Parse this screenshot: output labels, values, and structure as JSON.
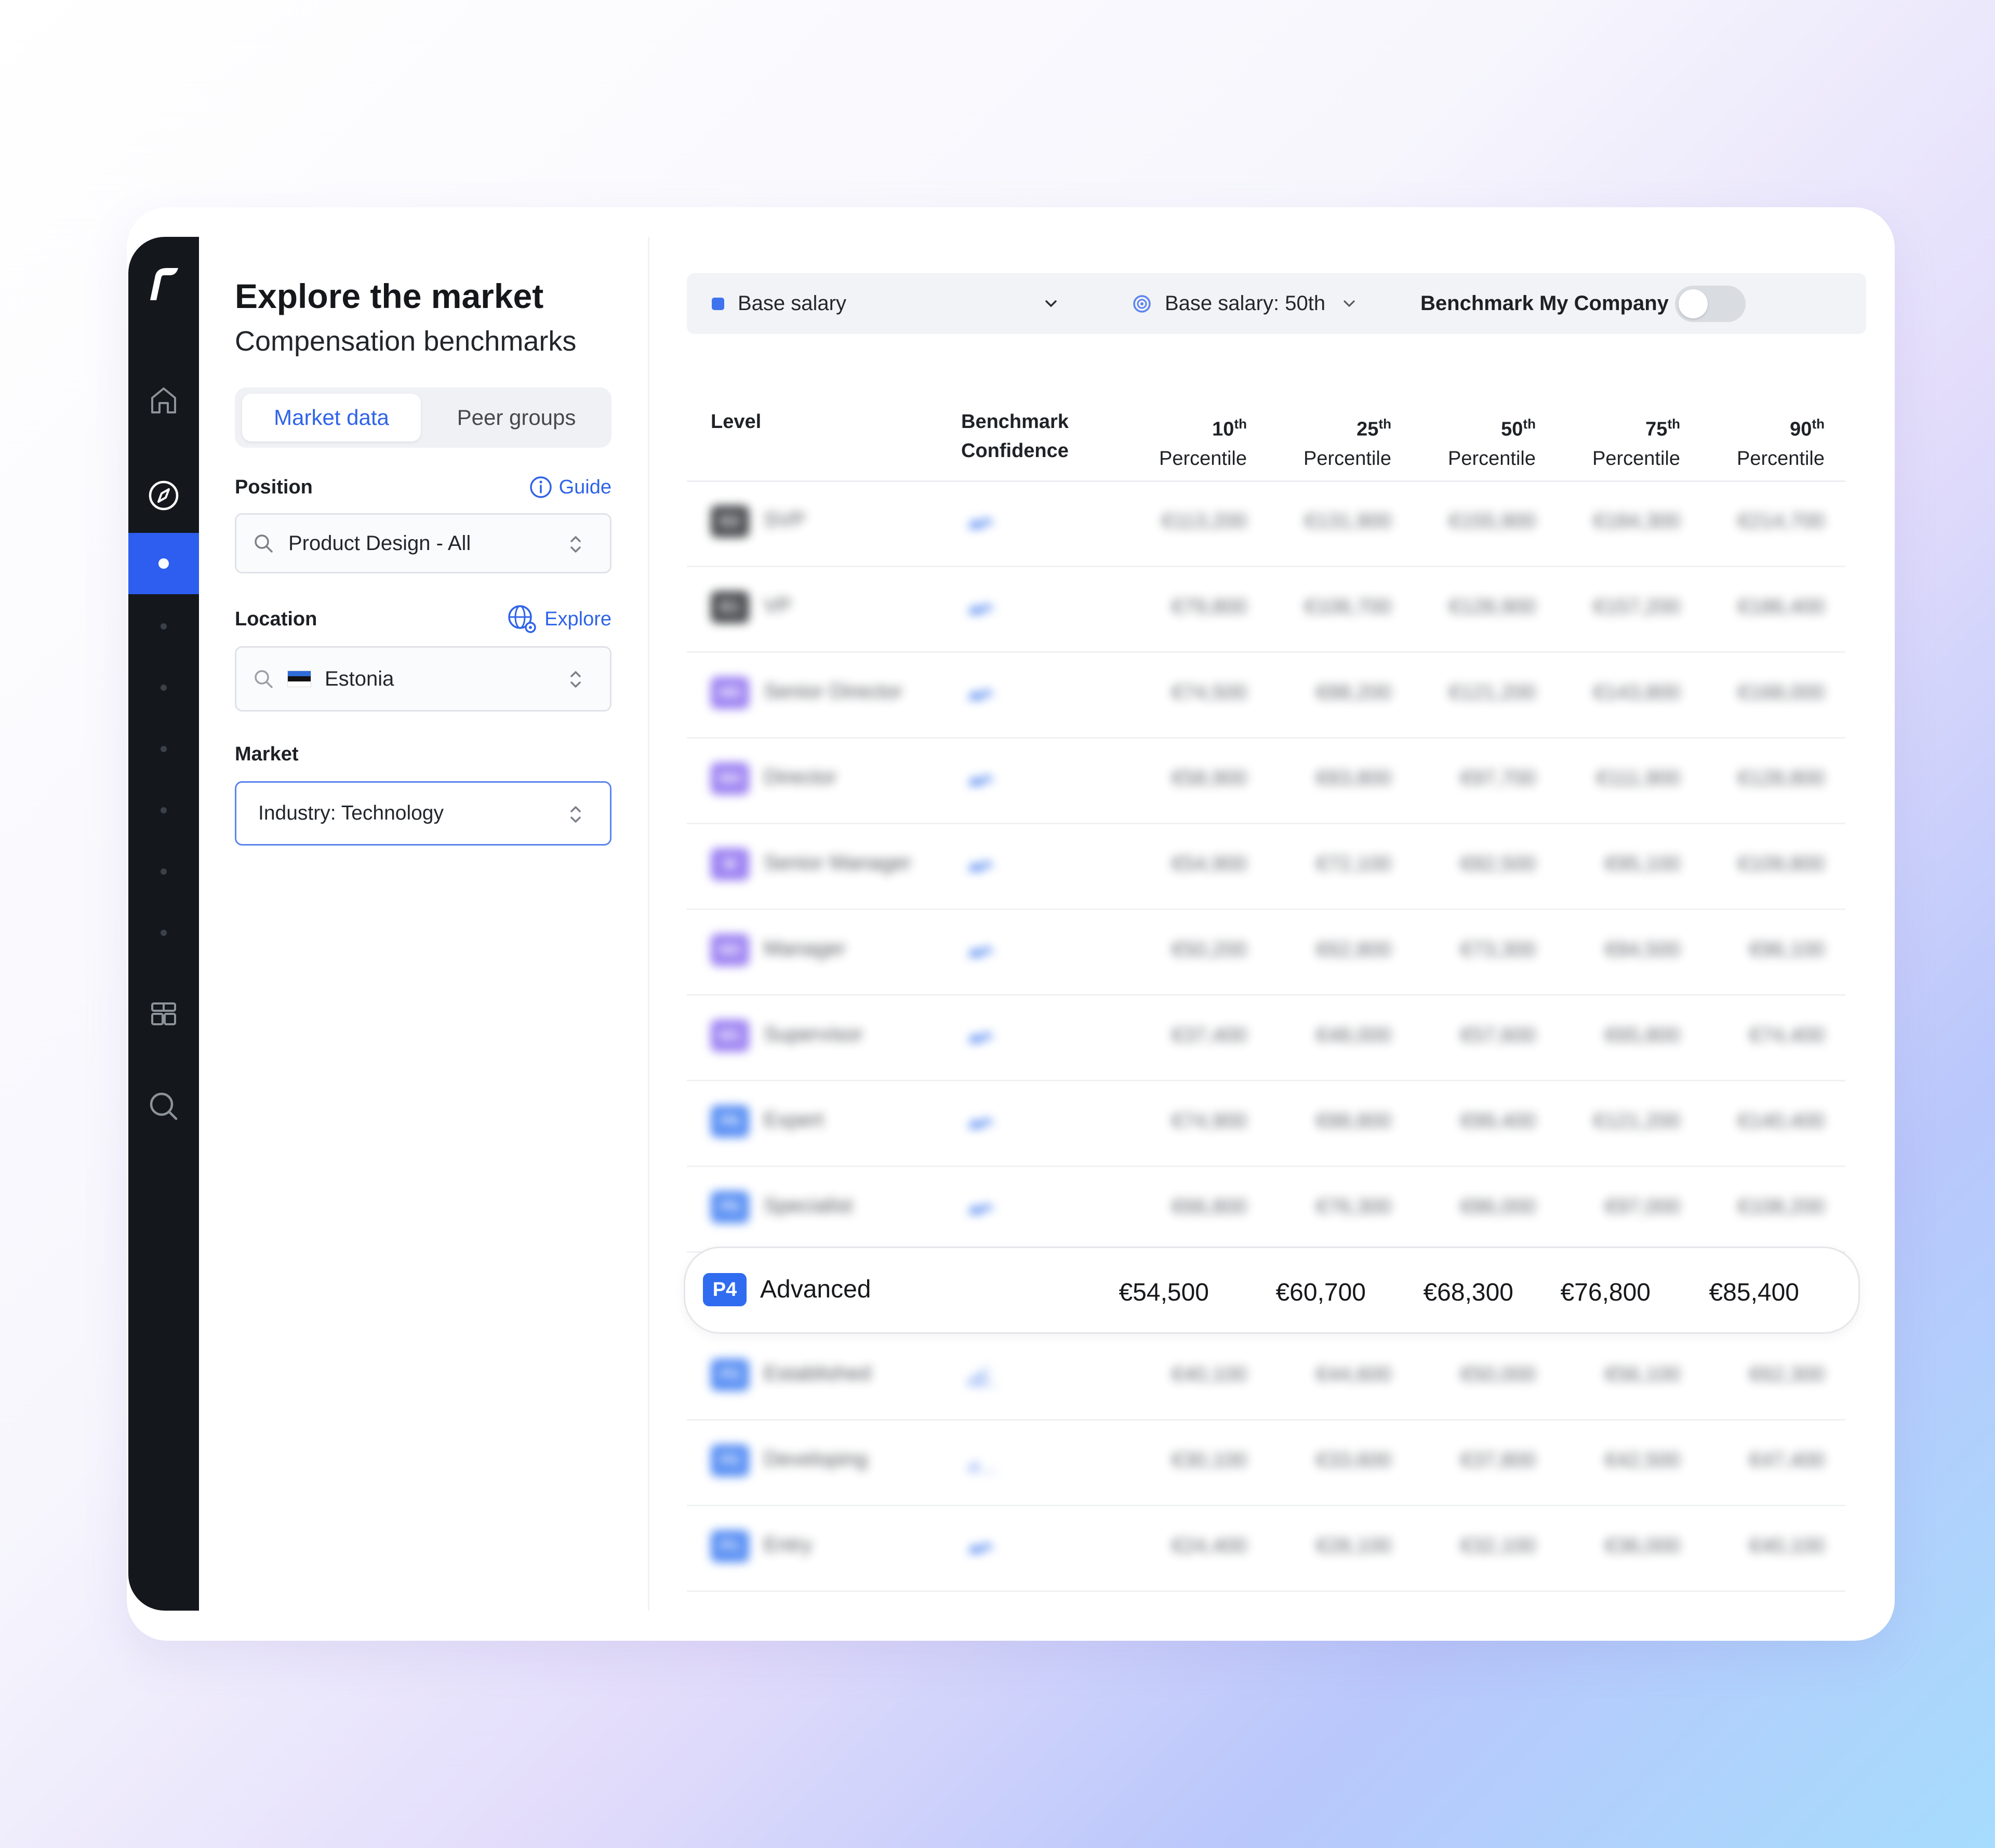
{
  "sidebar": {
    "logo": "r",
    "icons": [
      "home-icon",
      "compass-icon",
      "active-dot",
      "dashboard-icon",
      "search-icon"
    ]
  },
  "panel": {
    "title": "Explore the market",
    "subtitle": "Compensation benchmarks",
    "tabs": [
      {
        "label": "Market data",
        "active": true
      },
      {
        "label": "Peer groups",
        "active": false
      }
    ],
    "position": {
      "label": "Position",
      "link": "Guide",
      "value": "Product Design  -  All"
    },
    "location": {
      "label": "Location",
      "link": "Explore",
      "value": "Estonia"
    },
    "market": {
      "label": "Market",
      "value": "Industry: Technology"
    }
  },
  "toolbar": {
    "metric": "Base salary",
    "benchmark": "Base salary: 50th",
    "toggle_label": "Benchmark My Company",
    "toggle_on": false,
    "accent": "#2f63e8"
  },
  "table": {
    "headers": {
      "level": "Level",
      "confidence_1": "Benchmark",
      "confidence_2": "Confidence",
      "p10_num": "10",
      "p25_num": "25",
      "p50_num": "50",
      "p75_num": "75",
      "p90_num": "90",
      "suffix": "th",
      "percentile": "Percentile"
    },
    "rows": [
      {
        "badge": "E2",
        "level": "SVP",
        "color": "#2c2f33",
        "values": [
          "€113,200",
          "€131,900",
          "€155,900",
          "€184,300",
          "€214,700"
        ]
      },
      {
        "badge": "E1",
        "level": "VP",
        "color": "#2c2f33",
        "values": [
          "€79,800",
          "€106,700",
          "€128,900",
          "€157,200",
          "€186,400"
        ]
      },
      {
        "badge": "M5",
        "level": "Senior Director",
        "color": "#8b6cf0",
        "values": [
          "€74,500",
          "€88,200",
          "€121,200",
          "€143,800",
          "€168,000"
        ]
      },
      {
        "badge": "M4",
        "level": "Director",
        "color": "#8b6cf0",
        "values": [
          "€58,900",
          "€83,800",
          "€97,700",
          "€111,900",
          "€128,800"
        ]
      },
      {
        "badge": "M",
        "level": "Senior Manager",
        "color": "#8b6cf0",
        "values": [
          "€54,900",
          "€72,100",
          "€82,500",
          "€95,100",
          "€109,800"
        ]
      },
      {
        "badge": "M2",
        "level": "Manager",
        "color": "#8b6cf0",
        "values": [
          "€50,200",
          "€62,800",
          "€73,300",
          "€84,500",
          "€96,100"
        ]
      },
      {
        "badge": "M1",
        "level": "Supervisor",
        "color": "#8b6cf0",
        "values": [
          "€37,400",
          "€48,000",
          "€57,600",
          "€65,800",
          "€74,400"
        ]
      },
      {
        "badge": "P6",
        "level": "Expert",
        "color": "#3b7bf2",
        "values": [
          "€74,900",
          "€88,800",
          "€99,400",
          "€121,200",
          "€140,400"
        ]
      },
      {
        "badge": "P5",
        "level": "Specialist",
        "color": "#3b7bf2",
        "values": [
          "€66,800",
          "€76,300",
          "€86,000",
          "€97,000",
          "€108,200"
        ]
      }
    ],
    "highlight": {
      "badge": "P4",
      "level": "Advanced",
      "values": [
        "€54,500",
        "€60,700",
        "€68,300",
        "€76,800",
        "€85,400"
      ]
    },
    "rows_after": [
      {
        "badge": "P3",
        "level": "Established",
        "color": "#3b7bf2",
        "values": [
          "€40,100",
          "€44,600",
          "€50,000",
          "€56,100",
          "€62,300"
        ]
      },
      {
        "badge": "P2",
        "level": "Developing",
        "color": "#3b7bf2",
        "values": [
          "€30,100",
          "€33,600",
          "€37,800",
          "€42,500",
          "€47,400"
        ]
      },
      {
        "badge": "P1",
        "level": "Entry",
        "color": "#3b7bf2",
        "values": [
          "€24,400",
          "€28,100",
          "€32,100",
          "€36,000",
          "€40,100"
        ]
      }
    ]
  }
}
